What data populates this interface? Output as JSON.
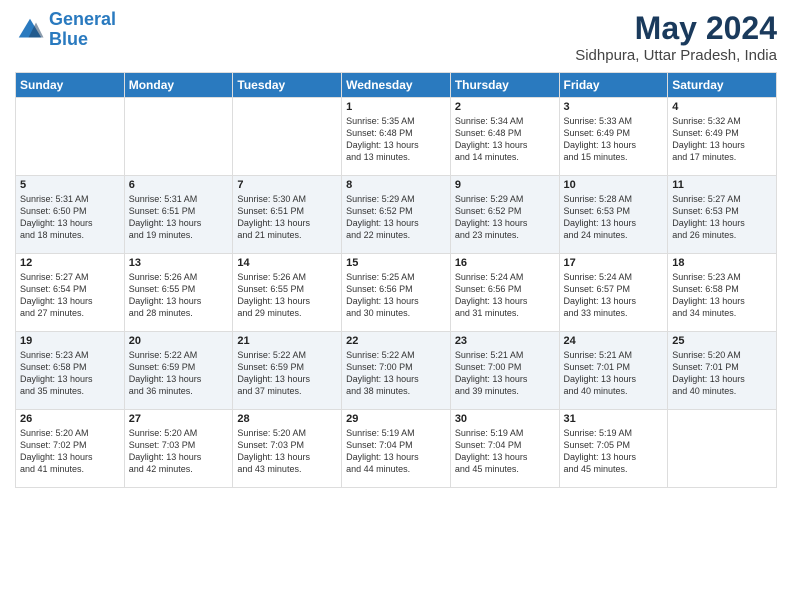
{
  "logo": {
    "line1": "General",
    "line2": "Blue"
  },
  "title": "May 2024",
  "subtitle": "Sidhpura, Uttar Pradesh, India",
  "headers": [
    "Sunday",
    "Monday",
    "Tuesday",
    "Wednesday",
    "Thursday",
    "Friday",
    "Saturday"
  ],
  "weeks": [
    [
      {
        "day": "",
        "info": ""
      },
      {
        "day": "",
        "info": ""
      },
      {
        "day": "",
        "info": ""
      },
      {
        "day": "1",
        "info": "Sunrise: 5:35 AM\nSunset: 6:48 PM\nDaylight: 13 hours\nand 13 minutes."
      },
      {
        "day": "2",
        "info": "Sunrise: 5:34 AM\nSunset: 6:48 PM\nDaylight: 13 hours\nand 14 minutes."
      },
      {
        "day": "3",
        "info": "Sunrise: 5:33 AM\nSunset: 6:49 PM\nDaylight: 13 hours\nand 15 minutes."
      },
      {
        "day": "4",
        "info": "Sunrise: 5:32 AM\nSunset: 6:49 PM\nDaylight: 13 hours\nand 17 minutes."
      }
    ],
    [
      {
        "day": "5",
        "info": "Sunrise: 5:31 AM\nSunset: 6:50 PM\nDaylight: 13 hours\nand 18 minutes."
      },
      {
        "day": "6",
        "info": "Sunrise: 5:31 AM\nSunset: 6:51 PM\nDaylight: 13 hours\nand 19 minutes."
      },
      {
        "day": "7",
        "info": "Sunrise: 5:30 AM\nSunset: 6:51 PM\nDaylight: 13 hours\nand 21 minutes."
      },
      {
        "day": "8",
        "info": "Sunrise: 5:29 AM\nSunset: 6:52 PM\nDaylight: 13 hours\nand 22 minutes."
      },
      {
        "day": "9",
        "info": "Sunrise: 5:29 AM\nSunset: 6:52 PM\nDaylight: 13 hours\nand 23 minutes."
      },
      {
        "day": "10",
        "info": "Sunrise: 5:28 AM\nSunset: 6:53 PM\nDaylight: 13 hours\nand 24 minutes."
      },
      {
        "day": "11",
        "info": "Sunrise: 5:27 AM\nSunset: 6:53 PM\nDaylight: 13 hours\nand 26 minutes."
      }
    ],
    [
      {
        "day": "12",
        "info": "Sunrise: 5:27 AM\nSunset: 6:54 PM\nDaylight: 13 hours\nand 27 minutes."
      },
      {
        "day": "13",
        "info": "Sunrise: 5:26 AM\nSunset: 6:55 PM\nDaylight: 13 hours\nand 28 minutes."
      },
      {
        "day": "14",
        "info": "Sunrise: 5:26 AM\nSunset: 6:55 PM\nDaylight: 13 hours\nand 29 minutes."
      },
      {
        "day": "15",
        "info": "Sunrise: 5:25 AM\nSunset: 6:56 PM\nDaylight: 13 hours\nand 30 minutes."
      },
      {
        "day": "16",
        "info": "Sunrise: 5:24 AM\nSunset: 6:56 PM\nDaylight: 13 hours\nand 31 minutes."
      },
      {
        "day": "17",
        "info": "Sunrise: 5:24 AM\nSunset: 6:57 PM\nDaylight: 13 hours\nand 33 minutes."
      },
      {
        "day": "18",
        "info": "Sunrise: 5:23 AM\nSunset: 6:58 PM\nDaylight: 13 hours\nand 34 minutes."
      }
    ],
    [
      {
        "day": "19",
        "info": "Sunrise: 5:23 AM\nSunset: 6:58 PM\nDaylight: 13 hours\nand 35 minutes."
      },
      {
        "day": "20",
        "info": "Sunrise: 5:22 AM\nSunset: 6:59 PM\nDaylight: 13 hours\nand 36 minutes."
      },
      {
        "day": "21",
        "info": "Sunrise: 5:22 AM\nSunset: 6:59 PM\nDaylight: 13 hours\nand 37 minutes."
      },
      {
        "day": "22",
        "info": "Sunrise: 5:22 AM\nSunset: 7:00 PM\nDaylight: 13 hours\nand 38 minutes."
      },
      {
        "day": "23",
        "info": "Sunrise: 5:21 AM\nSunset: 7:00 PM\nDaylight: 13 hours\nand 39 minutes."
      },
      {
        "day": "24",
        "info": "Sunrise: 5:21 AM\nSunset: 7:01 PM\nDaylight: 13 hours\nand 40 minutes."
      },
      {
        "day": "25",
        "info": "Sunrise: 5:20 AM\nSunset: 7:01 PM\nDaylight: 13 hours\nand 40 minutes."
      }
    ],
    [
      {
        "day": "26",
        "info": "Sunrise: 5:20 AM\nSunset: 7:02 PM\nDaylight: 13 hours\nand 41 minutes."
      },
      {
        "day": "27",
        "info": "Sunrise: 5:20 AM\nSunset: 7:03 PM\nDaylight: 13 hours\nand 42 minutes."
      },
      {
        "day": "28",
        "info": "Sunrise: 5:20 AM\nSunset: 7:03 PM\nDaylight: 13 hours\nand 43 minutes."
      },
      {
        "day": "29",
        "info": "Sunrise: 5:19 AM\nSunset: 7:04 PM\nDaylight: 13 hours\nand 44 minutes."
      },
      {
        "day": "30",
        "info": "Sunrise: 5:19 AM\nSunset: 7:04 PM\nDaylight: 13 hours\nand 45 minutes."
      },
      {
        "day": "31",
        "info": "Sunrise: 5:19 AM\nSunset: 7:05 PM\nDaylight: 13 hours\nand 45 minutes."
      },
      {
        "day": "",
        "info": ""
      }
    ]
  ]
}
